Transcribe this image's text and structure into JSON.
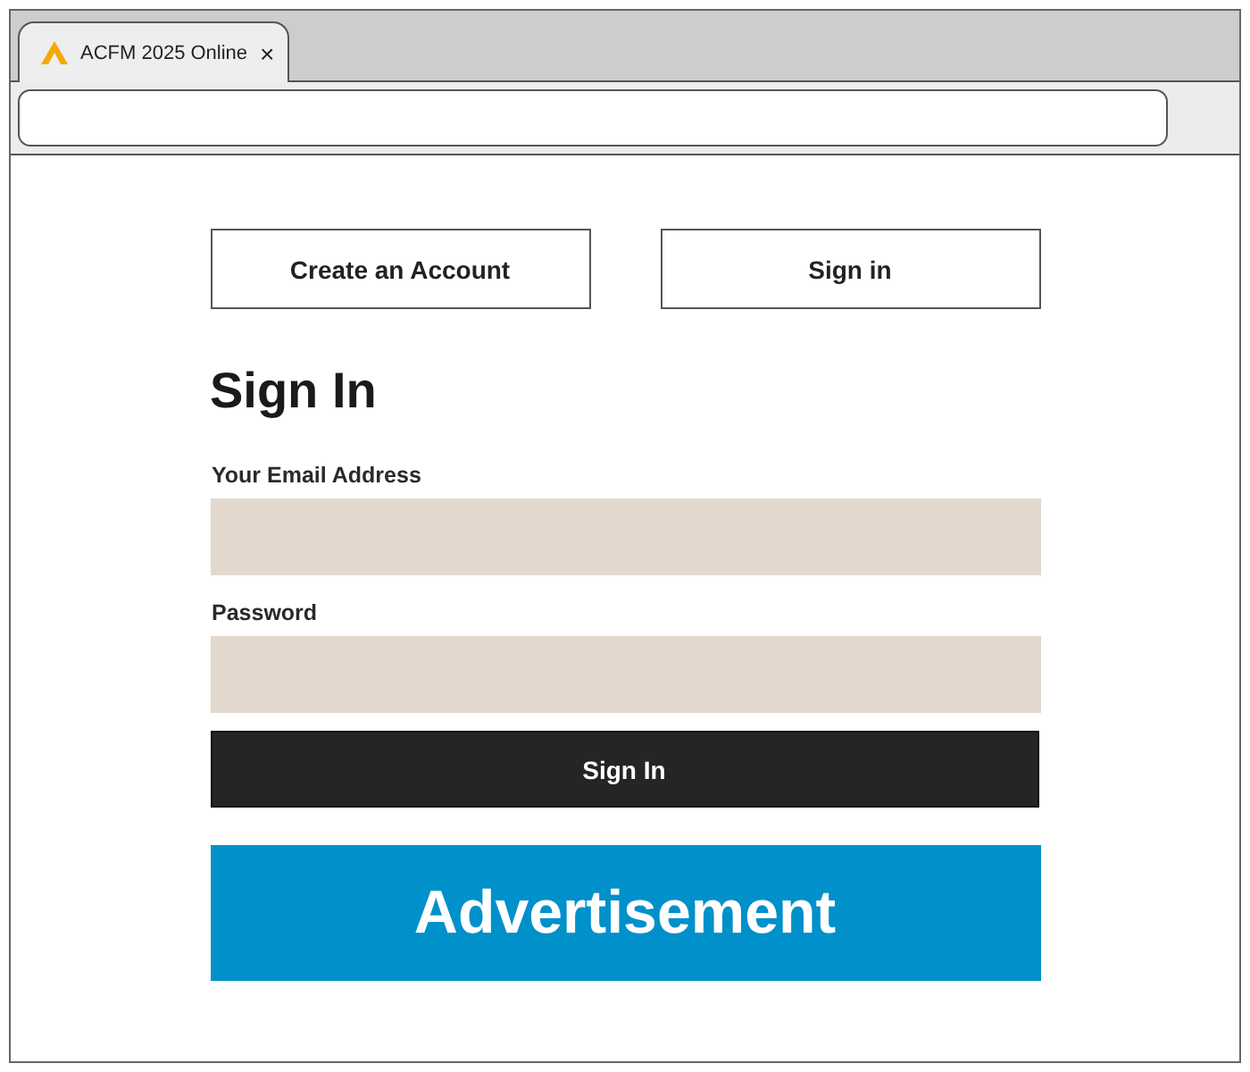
{
  "browser": {
    "tab": {
      "title": "ACFM 2025 Online",
      "close": "×"
    }
  },
  "account_buttons": [
    "Create an Account",
    "Sign in"
  ],
  "heading": "Sign In",
  "fields": [
    {
      "label": "Your Email Address"
    },
    {
      "label": "Password"
    }
  ],
  "submit": "Sign In",
  "advertisement": "Advertisement"
}
